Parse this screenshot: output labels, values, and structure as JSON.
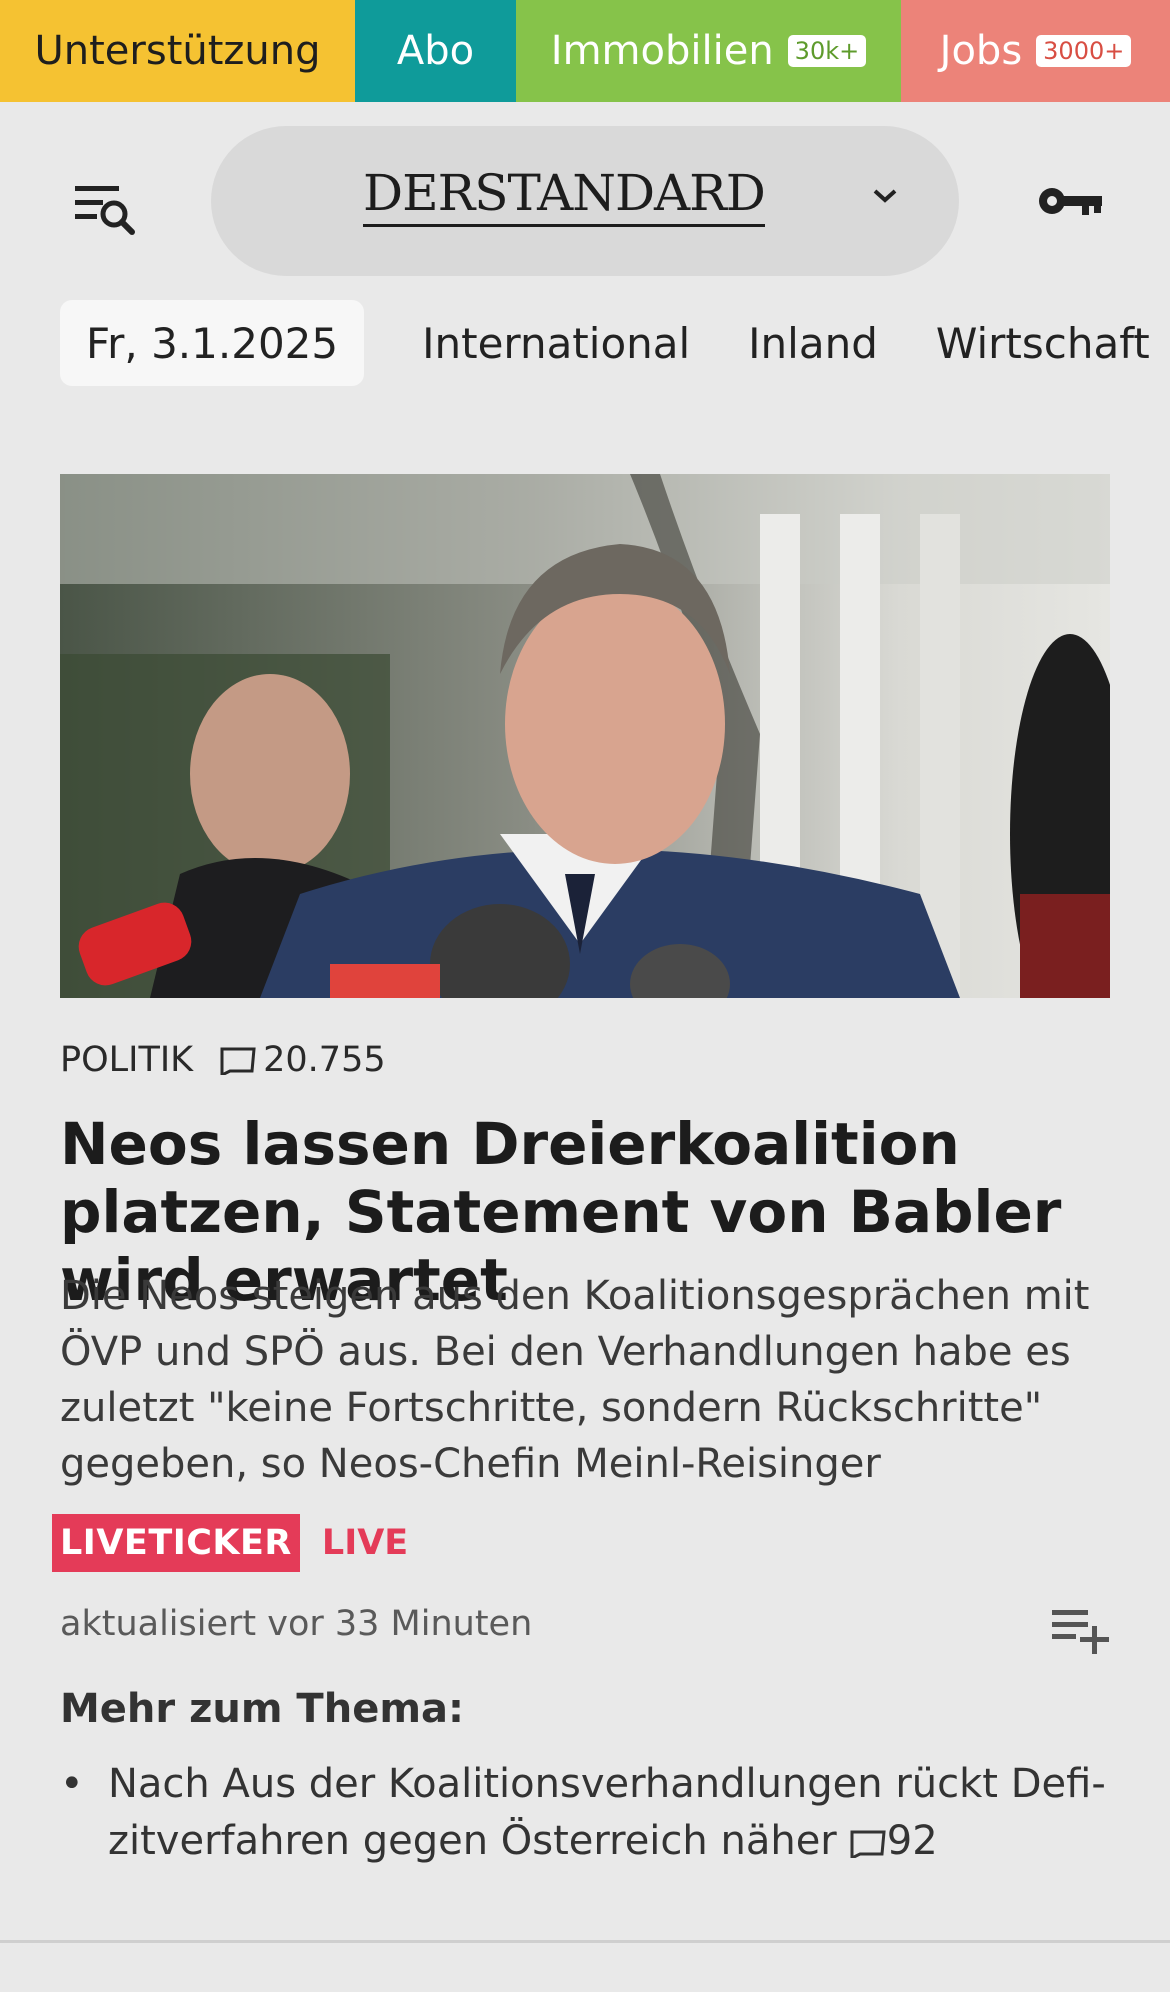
{
  "topbar": {
    "support": "Unterstützung",
    "abo": "Abo",
    "immobilien": "Immobilien",
    "immobilien_badge": "30k+",
    "jobs": "Jobs",
    "jobs_badge": "3000+"
  },
  "header": {
    "logo": "DERSTANDARD"
  },
  "nav": {
    "date": "Fr, 3.1.2025",
    "items": [
      "International",
      "Inland",
      "Wirtschaft"
    ]
  },
  "article": {
    "section": "POLITIK",
    "comments": "20.755",
    "headline": "Neos lassen Dreierkoalition platzen, Statement von Babler wird erwartet",
    "teaser": "Die Neos steigen aus den Koalitionsgesprächen mit ÖVP und SPÖ aus. Bei den Verhandlungen habe es zuletzt \"keine Fortschritte, sondern Rückschritte\" gegeben, so Neos-Chefin Meinl-Reisinger",
    "liveticker_label": "LIVETICKER",
    "live_label": "LIVE",
    "updated": "aktualisiert vor 33 Minuten"
  },
  "more": {
    "title": "Mehr zum Thema:",
    "items": [
      {
        "text": "Nach Aus der Koalitionsverhandlungen rückt Defi­zitverfahren gegen Österreich näher",
        "comments": "92"
      }
    ]
  },
  "colors": {
    "support": "#f5c232",
    "abo": "#0f9b9a",
    "immobilien": "#86c34a",
    "jobs": "#ec8379",
    "live": "#e43b58"
  }
}
